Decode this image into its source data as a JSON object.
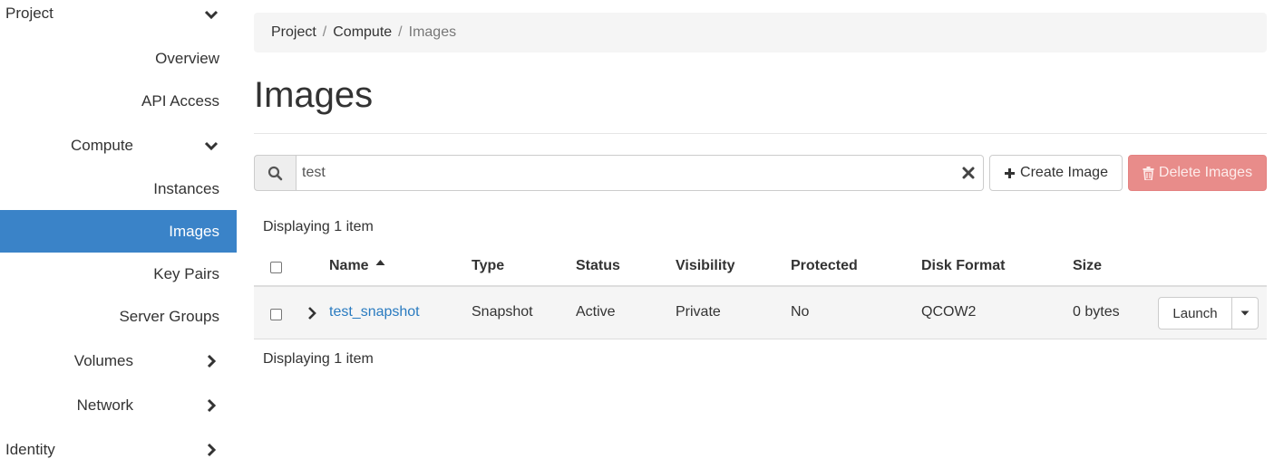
{
  "sidebar": {
    "project": {
      "label": "Project",
      "icon": "chevron-down-icon"
    },
    "overview": {
      "label": "Overview"
    },
    "api_access": {
      "label": "API Access"
    },
    "compute": {
      "label": "Compute",
      "icon": "chevron-down-icon"
    },
    "instances": {
      "label": "Instances"
    },
    "images": {
      "label": "Images",
      "active": true
    },
    "key_pairs": {
      "label": "Key Pairs"
    },
    "server_groups": {
      "label": "Server Groups"
    },
    "volumes": {
      "label": "Volumes",
      "icon": "chevron-right-icon"
    },
    "network": {
      "label": "Network",
      "icon": "chevron-right-icon"
    },
    "identity": {
      "label": "Identity",
      "icon": "chevron-right-icon"
    }
  },
  "breadcrumb": {
    "items": [
      "Project",
      "Compute",
      "Images"
    ],
    "separator": "/"
  },
  "page": {
    "title": "Images"
  },
  "toolbar": {
    "search_icon": "search-icon",
    "search_value": "test",
    "clear_icon": "close-icon",
    "create_label": "Create Image",
    "create_icon": "plus-icon",
    "delete_label": "Delete Images",
    "delete_icon": "trash-icon"
  },
  "table": {
    "count_label": "Displaying 1 item",
    "sort_icon": "sort-asc-icon",
    "columns": [
      "Name",
      "Type",
      "Status",
      "Visibility",
      "Protected",
      "Disk Format",
      "Size"
    ],
    "rows": [
      {
        "name": "test_snapshot",
        "type": "Snapshot",
        "status": "Active",
        "visibility": "Private",
        "protected": "No",
        "disk_format": "QCOW2",
        "size": "0 bytes",
        "action_label": "Launch"
      }
    ]
  },
  "colors": {
    "active_nav": "#3a83c8",
    "link": "#2a7bc0",
    "danger": "#e88c8a"
  }
}
